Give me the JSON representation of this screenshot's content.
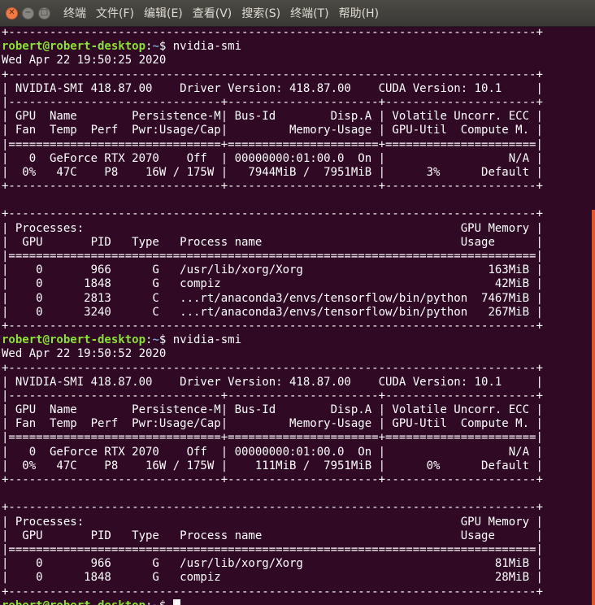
{
  "window": {
    "close_glyph": "✕",
    "minimize_glyph": "−",
    "maximize_glyph": "□",
    "menu": [
      "终端",
      "文件(F)",
      "编辑(E)",
      "查看(V)",
      "搜索(S)",
      "终端(T)",
      "帮助(H)"
    ]
  },
  "prompt": {
    "user_host": "robert@robert-desktop",
    "sep": ":",
    "path": "~",
    "symbol": "$"
  },
  "lines": [
    {
      "text": "+-----------------------------------------------------------------------------+"
    },
    {
      "prompt": true,
      "cmd": " nvidia-smi"
    },
    {
      "text": "Wed Apr 22 19:50:25 2020"
    },
    {
      "text": "+-----------------------------------------------------------------------------+"
    },
    {
      "text": "| NVIDIA-SMI 418.87.00    Driver Version: 418.87.00    CUDA Version: 10.1     |"
    },
    {
      "text": "|-------------------------------+----------------------+----------------------+"
    },
    {
      "text": "| GPU  Name        Persistence-M| Bus-Id        Disp.A | Volatile Uncorr. ECC |"
    },
    {
      "text": "| Fan  Temp  Perf  Pwr:Usage/Cap|         Memory-Usage | GPU-Util  Compute M. |"
    },
    {
      "text": "|===============================+======================+======================|"
    },
    {
      "text": "|   0  GeForce RTX 2070    Off  | 00000000:01:00.0  On |                  N/A |"
    },
    {
      "text": "|  0%   47C    P8    16W / 175W |   7944MiB /  7951MiB |      3%      Default |"
    },
    {
      "text": "+-------------------------------+----------------------+----------------------+"
    },
    {
      "text": ""
    },
    {
      "text": "+-----------------------------------------------------------------------------+"
    },
    {
      "text": "| Processes:                                                       GPU Memory |"
    },
    {
      "text": "|  GPU       PID   Type   Process name                             Usage      |"
    },
    {
      "text": "|=============================================================================|"
    },
    {
      "text": "|    0       966      G   /usr/lib/xorg/Xorg                           163MiB |"
    },
    {
      "text": "|    0      1848      G   compiz                                        42MiB |"
    },
    {
      "text": "|    0      2813      C   ...rt/anaconda3/envs/tensorflow/bin/python  7467MiB |"
    },
    {
      "text": "|    0      3240      C   ...rt/anaconda3/envs/tensorflow/bin/python   267MiB |"
    },
    {
      "text": "+-----------------------------------------------------------------------------+"
    },
    {
      "prompt": true,
      "cmd": " nvidia-smi"
    },
    {
      "text": "Wed Apr 22 19:50:52 2020"
    },
    {
      "text": "+-----------------------------------------------------------------------------+"
    },
    {
      "text": "| NVIDIA-SMI 418.87.00    Driver Version: 418.87.00    CUDA Version: 10.1     |"
    },
    {
      "text": "|-------------------------------+----------------------+----------------------+"
    },
    {
      "text": "| GPU  Name        Persistence-M| Bus-Id        Disp.A | Volatile Uncorr. ECC |"
    },
    {
      "text": "| Fan  Temp  Perf  Pwr:Usage/Cap|         Memory-Usage | GPU-Util  Compute M. |"
    },
    {
      "text": "|===============================+======================+======================|"
    },
    {
      "text": "|   0  GeForce RTX 2070    Off  | 00000000:01:00.0  On |                  N/A |"
    },
    {
      "text": "|  0%   47C    P8    16W / 175W |    111MiB /  7951MiB |      0%      Default |"
    },
    {
      "text": "+-------------------------------+----------------------+----------------------+"
    },
    {
      "text": ""
    },
    {
      "text": "+-----------------------------------------------------------------------------+"
    },
    {
      "text": "| Processes:                                                       GPU Memory |"
    },
    {
      "text": "|  GPU       PID   Type   Process name                             Usage      |"
    },
    {
      "text": "|=============================================================================|"
    },
    {
      "text": "|    0       966      G   /usr/lib/xorg/Xorg                            81MiB |"
    },
    {
      "text": "|    0      1848      G   compiz                                        28MiB |"
    },
    {
      "text": "+-----------------------------------------------------------------------------+"
    },
    {
      "prompt": true,
      "cmd": " ",
      "cursor": true
    }
  ],
  "colors": {
    "background": "#300a24",
    "prompt_user": "#8ae234",
    "prompt_path": "#729fcf",
    "scrollbar": "#e95420"
  }
}
